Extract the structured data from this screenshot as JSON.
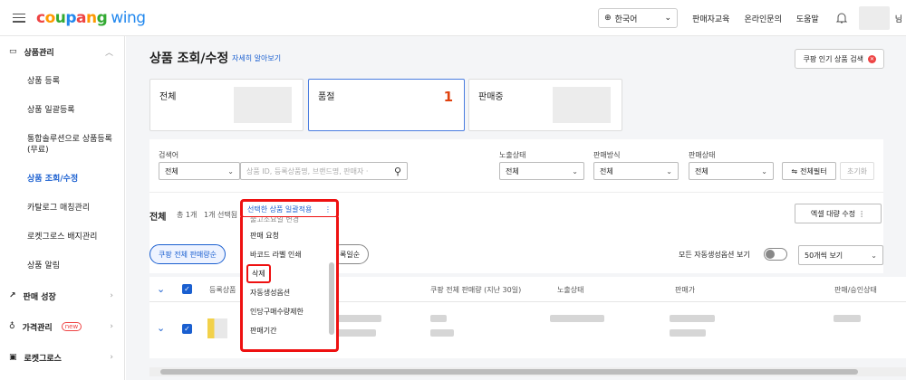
{
  "header": {
    "logo_parts": [
      "c",
      "o",
      "u",
      "p",
      "a",
      "n",
      "g"
    ],
    "logo_wing": "wing",
    "language": "한국어",
    "links": [
      "판매자교육",
      "온라인문의",
      "도움말"
    ],
    "user_suffix": "님"
  },
  "sidebar": {
    "group_product": "상품관리",
    "items": [
      "상품 등록",
      "상품 일괄등록",
      "통합솔루션으로 상품등록 (무료)",
      "상품 조회/수정",
      "카탈로그 매칭관리",
      "로켓그로스 배지관리",
      "상품 알림"
    ],
    "active_index": 3,
    "group_growth": "판매 성장",
    "group_price": "가격관리",
    "new_badge": "new",
    "group_rocket": "로켓그로스"
  },
  "page": {
    "title": "상품 조회/수정",
    "more_link": "자세히 알아보기",
    "popular_button": "쿠팡 인기 상품 검색"
  },
  "cards": [
    {
      "label": "전체"
    },
    {
      "label": "품절",
      "count": "1"
    },
    {
      "label": "판매중"
    }
  ],
  "filters": {
    "search_label": "검색어",
    "search_scope": "전체",
    "search_placeholder": "상품 ID, 등록상품명, 브랜드명, 판매자 ·",
    "exposure_label": "노출상태",
    "exposure_value": "전체",
    "method_label": "판매방식",
    "method_value": "전체",
    "status_label": "판매상태",
    "status_value": "전체",
    "all_filter": "전체필터",
    "reset": "초기화"
  },
  "list": {
    "heading": "전체",
    "total": "총 1개",
    "selected": "1개 선택됨",
    "bulk_apply": "선택한 상품 일괄적용",
    "excel": "엑셀 대량 수정",
    "pill_sales": "쿠팡 전체 판매량순",
    "pill_reg": "록일순",
    "auto_option": "모든 자동생성옵션 보기",
    "page_size": "50개씩 보기"
  },
  "dropdown": {
    "cut_item": "출고소요일 변경",
    "items": [
      "판매 요청",
      "바코드 라벨 인쇄",
      "삭제",
      "자동생성옵션",
      "인당구매수량제한",
      "판매기간"
    ],
    "highlight_index": 2
  },
  "table": {
    "headers": [
      "등록상품",
      "쿠팡 전체 판매량 (지난 30일)",
      "노출상태",
      "판매가",
      "판매/승인상태"
    ]
  },
  "colors": {
    "accent": "#1a5fd0",
    "highlight": "#e11"
  }
}
